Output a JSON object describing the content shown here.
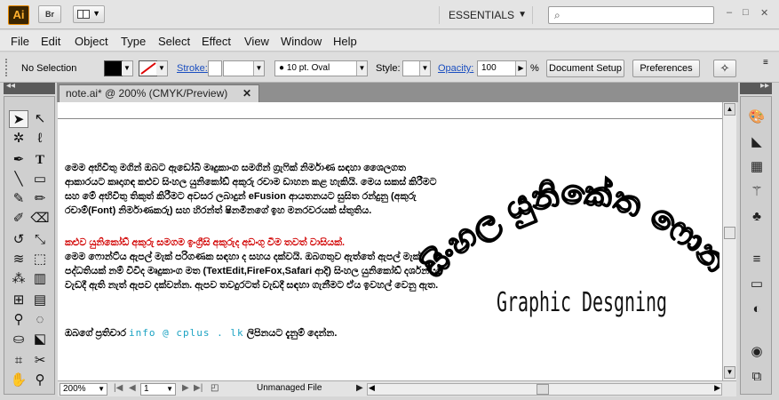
{
  "titlebar": {
    "app_logo": "Ai",
    "bridge_label": "Br",
    "workspace": "ESSENTIALS",
    "search_placeholder": "",
    "min": "–",
    "max": "□",
    "close": "✕"
  },
  "menu": [
    "File",
    "Edit",
    "Object",
    "Type",
    "Select",
    "Effect",
    "View",
    "Window",
    "Help"
  ],
  "control": {
    "selection": "No Selection",
    "stroke_label": "Stroke:",
    "brush": "10 pt. Oval",
    "style_label": "Style:",
    "opacity_label": "Opacity:",
    "opacity_value": "100",
    "opacity_unit": "%",
    "doc_setup": "Document Setup",
    "preferences": "Preferences"
  },
  "document": {
    "tab_title": "note.ai* @ 200% (CMYK/Preview)",
    "tab_close": "✕"
  },
  "canvas": {
    "para1": "මෙම අභිවිතු මගින් ඔබට ඇඩෝබි මෘදුකාංග සමගින් ග්‍රැෆික් නිර්මාණ සඳහා ශෛලගත ආකාරයට කෘදාගඳ කළුව සිංහල යුනිකෝඩ් අකුරු රචාම ඩාහන කළ හැකියි. මෙය සකස් කිරීමට සහ මේ අභිවිතු තිකුත් කිරීමට අවසර ලබාදුන් eFusion ආයතනයට සුසිත රන්දුනු (අකුරු රචාම්(Font) නිර්මාණකරු) සහ හිරන්ත් ෂිනමිනගේ ඉහ මනරවරයක් ස්තුතිය.",
    "para2_red": "කළුව යුනිකෝඩ් අකුරු සමගම ඉංග්‍රීසි අකුරුද අඩංගු වීම තවත් වාසියක්.",
    "para2": "මෙම ෆොන්ට්ය ඇපල් මැක් පරිගණක සඳහා ද සහය දක්වයි. ඔබගතුව ඇත්තේ ඇපල් මැක් පද්ධතියක් නම් විවිද මෘදුකාංග මත (TextEdit,FireFox,Safari ආදි) සිංහල යුනිකෝඩ් දර්ශනයට වැඩදී ඇති නැත් ඇපව දක්වන්න. ඇපව තවදුරටත් වැඩදී සඳහා ගැනීමට ඒය ඉවහල් වෙනු ඇත.",
    "para3_pre": "ඔබගේ ප්‍රතිචාර",
    "email": "info @ cplus . lk",
    "para3_post": "ලිපිනයට දැනුම් දෙන්න.",
    "art_sinhala": "සිංහල යුනිකේත ෆොන්ට්යන් සමග",
    "art_english": "Graphic Desgning"
  },
  "status": {
    "zoom": "200%",
    "page": "1",
    "mode": "Unmanaged File"
  }
}
